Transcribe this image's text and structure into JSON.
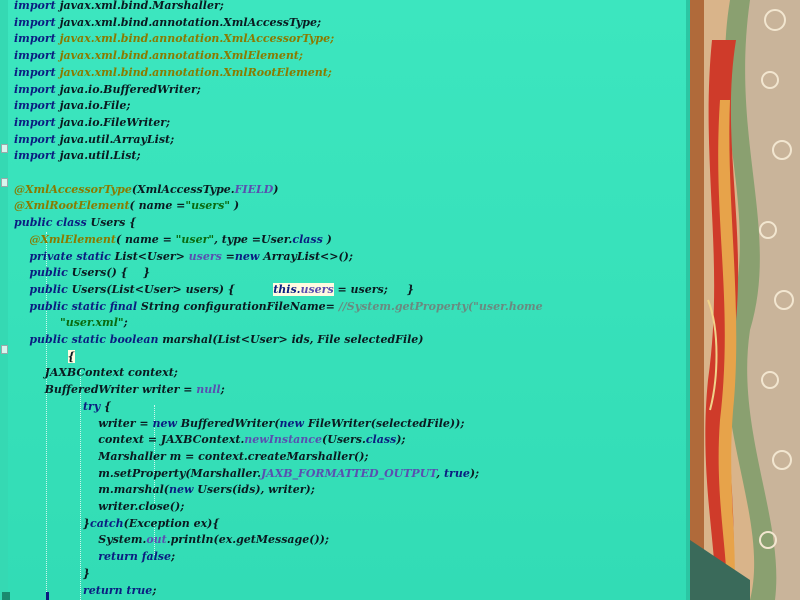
{
  "code_lines": [
    {
      "segs": [
        {
          "t": "import ",
          "c": "kw"
        },
        {
          "t": "javax.xml.bind.Marshaller;",
          "c": ""
        }
      ]
    },
    {
      "segs": [
        {
          "t": "import ",
          "c": "kw"
        },
        {
          "t": "javax.xml.bind.annotation.XmlAccessType;",
          "c": ""
        }
      ]
    },
    {
      "segs": [
        {
          "t": "import ",
          "c": "kw"
        },
        {
          "t": "javax.xml.bind.annotation.XmlAccessorType;",
          "c": "ann"
        }
      ]
    },
    {
      "segs": [
        {
          "t": "import ",
          "c": "kw"
        },
        {
          "t": "javax.xml.bind.annotation.XmlElement;",
          "c": "ann"
        }
      ]
    },
    {
      "segs": [
        {
          "t": "import ",
          "c": "kw"
        },
        {
          "t": "javax.xml.bind.annotation.XmlRootElement;",
          "c": "ann"
        }
      ]
    },
    {
      "segs": [
        {
          "t": "import ",
          "c": "kw"
        },
        {
          "t": "java.io.BufferedWriter;",
          "c": ""
        }
      ]
    },
    {
      "segs": [
        {
          "t": "import ",
          "c": "kw"
        },
        {
          "t": "java.io.File;",
          "c": ""
        }
      ]
    },
    {
      "segs": [
        {
          "t": "import ",
          "c": "kw"
        },
        {
          "t": "java.io.FileWriter;",
          "c": ""
        }
      ]
    },
    {
      "segs": [
        {
          "t": "import ",
          "c": "kw"
        },
        {
          "t": "java.util.ArrayList;",
          "c": ""
        }
      ]
    },
    {
      "segs": [
        {
          "t": "import ",
          "c": "kw"
        },
        {
          "t": "java.util.List;",
          "c": ""
        }
      ]
    },
    {
      "segs": []
    },
    {
      "segs": [
        {
          "t": "@XmlAccessorType",
          "c": "ann"
        },
        {
          "t": "(XmlAccessType.",
          "c": ""
        },
        {
          "t": "FIELD",
          "c": "fld"
        },
        {
          "t": ")",
          "c": ""
        }
      ]
    },
    {
      "segs": [
        {
          "t": "@XmlRootElement",
          "c": "ann"
        },
        {
          "t": "( name =",
          "c": ""
        },
        {
          "t": "\"users\"",
          "c": "str"
        },
        {
          "t": " )",
          "c": ""
        }
      ]
    },
    {
      "segs": [
        {
          "t": "public class ",
          "c": "kw"
        },
        {
          "t": "Users {",
          "c": ""
        }
      ]
    },
    {
      "segs": [
        {
          "t": "    ",
          "c": ""
        },
        {
          "t": "@XmlElement",
          "c": "ann"
        },
        {
          "t": "( name = ",
          "c": ""
        },
        {
          "t": "\"user\"",
          "c": "str"
        },
        {
          "t": ", type =User.",
          "c": ""
        },
        {
          "t": "class",
          "c": "kw"
        },
        {
          "t": " )",
          "c": ""
        }
      ]
    },
    {
      "segs": [
        {
          "t": "    ",
          "c": ""
        },
        {
          "t": "private static ",
          "c": "kw"
        },
        {
          "t": "List<User> ",
          "c": ""
        },
        {
          "t": "users",
          "c": "fld"
        },
        {
          "t": " =",
          "c": ""
        },
        {
          "t": "new ",
          "c": "kw"
        },
        {
          "t": "ArrayList<>();",
          "c": ""
        }
      ]
    },
    {
      "segs": [
        {
          "t": "    ",
          "c": ""
        },
        {
          "t": "public ",
          "c": "kw"
        },
        {
          "t": "Users() {    }",
          "c": ""
        }
      ]
    },
    {
      "segs": [
        {
          "t": "    ",
          "c": ""
        },
        {
          "t": "public ",
          "c": "kw"
        },
        {
          "t": "Users(List<User> users) {          ",
          "c": ""
        },
        {
          "t": "this.",
          "c": "kw hl"
        },
        {
          "t": "users",
          "c": "fld hl"
        },
        {
          "t": " = users;     }",
          "c": ""
        }
      ]
    },
    {
      "segs": [
        {
          "t": "    ",
          "c": ""
        },
        {
          "t": "public static final ",
          "c": "kw"
        },
        {
          "t": "String configurationFileName= ",
          "c": ""
        },
        {
          "t": "//System.getProperty(\"user.home",
          "c": "cm"
        }
      ]
    },
    {
      "segs": [
        {
          "t": "            ",
          "c": ""
        },
        {
          "t": "\"user.xml\"",
          "c": "str"
        },
        {
          "t": ";",
          "c": ""
        }
      ]
    },
    {
      "segs": [
        {
          "t": "    ",
          "c": ""
        },
        {
          "t": "public static boolean ",
          "c": "kw"
        },
        {
          "t": "marshal(List<User> ids, File selectedFile)",
          "c": ""
        }
      ]
    },
    {
      "segs": [
        {
          "t": "              ",
          "c": ""
        },
        {
          "t": "{",
          "c": "hl"
        }
      ]
    },
    {
      "segs": [
        {
          "t": "        JAXBContext context;",
          "c": ""
        }
      ]
    },
    {
      "segs": [
        {
          "t": "        BufferedWriter writer = ",
          "c": ""
        },
        {
          "t": "null",
          "c": "fld"
        },
        {
          "t": ";",
          "c": ""
        }
      ]
    },
    {
      "segs": [
        {
          "t": "                  ",
          "c": ""
        },
        {
          "t": "try ",
          "c": "kw"
        },
        {
          "t": "{",
          "c": ""
        }
      ]
    },
    {
      "segs": [
        {
          "t": "                      writer = ",
          "c": ""
        },
        {
          "t": "new ",
          "c": "kw"
        },
        {
          "t": "BufferedWriter(",
          "c": ""
        },
        {
          "t": "new ",
          "c": "kw"
        },
        {
          "t": "FileWriter(selectedFile));",
          "c": ""
        }
      ]
    },
    {
      "segs": [
        {
          "t": "                      context = JAXBContext.",
          "c": ""
        },
        {
          "t": "newInstance",
          "c": "fld"
        },
        {
          "t": "(Users.",
          "c": ""
        },
        {
          "t": "class",
          "c": "kw"
        },
        {
          "t": ");",
          "c": ""
        }
      ]
    },
    {
      "segs": [
        {
          "t": "                      Marshaller m = context.createMarshaller();",
          "c": ""
        }
      ]
    },
    {
      "segs": [
        {
          "t": "                      m.setProperty(Marshaller.",
          "c": ""
        },
        {
          "t": "JAXB_FORMATTED_OUTPUT",
          "c": "fld"
        },
        {
          "t": ", ",
          "c": ""
        },
        {
          "t": "true",
          "c": "kw"
        },
        {
          "t": ");",
          "c": ""
        }
      ]
    },
    {
      "segs": [
        {
          "t": "                      m.marshal(",
          "c": ""
        },
        {
          "t": "new ",
          "c": "kw"
        },
        {
          "t": "Users(ids), writer);",
          "c": ""
        }
      ]
    },
    {
      "segs": [
        {
          "t": "                      writer.close();",
          "c": ""
        }
      ]
    },
    {
      "segs": [
        {
          "t": "                  }",
          "c": ""
        },
        {
          "t": "catch",
          "c": "kw"
        },
        {
          "t": "(Exception ex){",
          "c": ""
        }
      ]
    },
    {
      "segs": [
        {
          "t": "                      System.",
          "c": ""
        },
        {
          "t": "out",
          "c": "fld"
        },
        {
          "t": ".println(ex.getMessage());",
          "c": ""
        }
      ]
    },
    {
      "segs": [
        {
          "t": "                      ",
          "c": ""
        },
        {
          "t": "return false",
          "c": "kw"
        },
        {
          "t": ";",
          "c": ""
        }
      ]
    },
    {
      "segs": [
        {
          "t": "                  }",
          "c": ""
        }
      ]
    },
    {
      "segs": [
        {
          "t": "                  ",
          "c": ""
        },
        {
          "t": "return true",
          "c": "kw"
        },
        {
          "t": ";",
          "c": ""
        }
      ]
    }
  ],
  "colors": {
    "editor_bg": "#3ce6bf",
    "keyword": "#0b1d80",
    "annotation": "#8a7a00",
    "string": "#0a6a10",
    "comment": "#6a8a80",
    "field": "#5a4fb0"
  }
}
